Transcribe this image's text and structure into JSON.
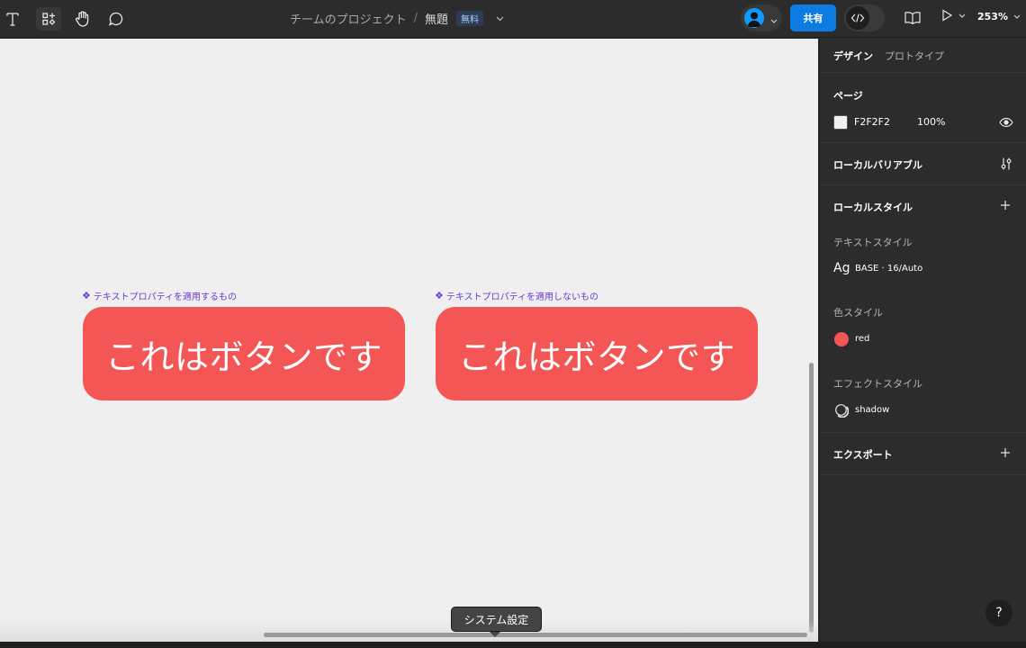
{
  "toolbar": {
    "tools": [
      "text-tool",
      "components-tool",
      "hand-tool",
      "comment-tool"
    ],
    "breadcrumb": {
      "project": "チームのプロジェクト",
      "separator": "/",
      "file_name": "無題",
      "plan_badge": "無料"
    },
    "share_label": "共有",
    "zoom": "253%"
  },
  "canvas": {
    "background": "#F2F2F2",
    "components": [
      {
        "label": "テキストプロパティを適用するもの",
        "button_text": "これはボタンです"
      },
      {
        "label": "テキストプロパティを適用しないもの",
        "button_text": "これはボタンです"
      }
    ],
    "tooltip": "システム設定"
  },
  "panel": {
    "tabs": [
      "デザイン",
      "プロトタイプ"
    ],
    "page": {
      "title": "ページ",
      "color_hex": "F2F2F2",
      "opacity": "100%"
    },
    "local_variables": "ローカルバリアブル",
    "local_styles": {
      "title": "ローカルスタイル",
      "text_styles": {
        "title": "テキストスタイル",
        "preview": "Ag",
        "name": "BASE · 16/Auto"
      },
      "color_styles": {
        "title": "色スタイル",
        "name": "red",
        "color": "#F45555"
      },
      "effect_styles": {
        "title": "エフェクトスタイル",
        "name": "shadow"
      }
    },
    "export": "エクスポート",
    "help": "?"
  },
  "colors": {
    "accent": "#0D7CE2",
    "component_purple": "#6B3BD1",
    "button_red": "#F45555"
  }
}
